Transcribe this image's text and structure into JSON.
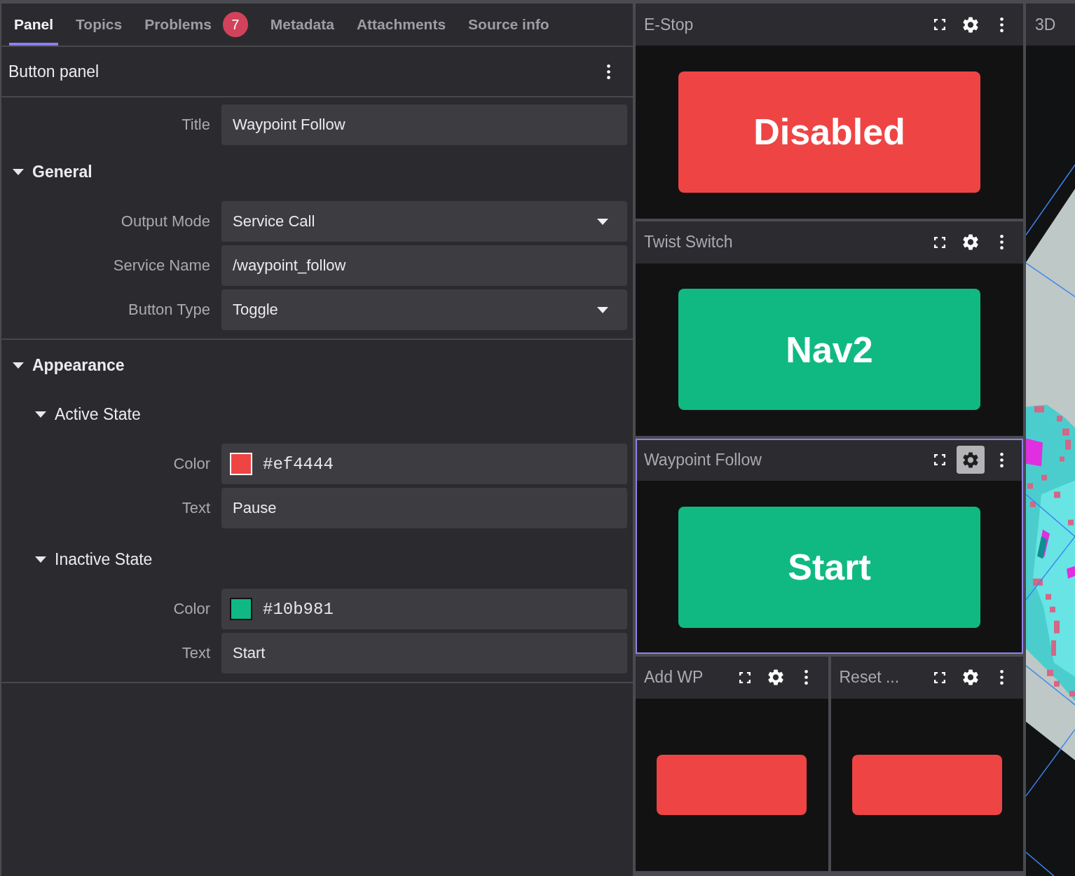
{
  "sidebar": {
    "tabs": [
      {
        "label": "Panel",
        "selected": true
      },
      {
        "label": "Topics",
        "selected": false
      },
      {
        "label": "Problems",
        "selected": false,
        "badge": "7"
      },
      {
        "label": "Metadata",
        "selected": false
      },
      {
        "label": "Attachments",
        "selected": false
      },
      {
        "label": "Source info",
        "selected": false
      }
    ],
    "title": "Button panel",
    "fields": [
      {
        "kind": "text",
        "label": "Title",
        "value": "Waypoint Follow"
      }
    ],
    "sections": [
      {
        "title": "General",
        "expanded": true,
        "fields": [
          {
            "kind": "select",
            "label": "Output Mode",
            "value": "Service Call"
          },
          {
            "kind": "text",
            "label": "Service Name",
            "value": "/waypoint_follow"
          },
          {
            "kind": "select",
            "label": "Button Type",
            "value": "Toggle"
          }
        ]
      },
      {
        "title": "Appearance",
        "expanded": true,
        "children": [
          {
            "title": "Active State",
            "expanded": true,
            "fields": [
              {
                "kind": "color",
                "label": "Color",
                "value": "#ef4444",
                "color": "#ef4444"
              },
              {
                "kind": "text",
                "label": "Text",
                "value": "Pause"
              }
            ]
          },
          {
            "title": "Inactive State",
            "expanded": true,
            "fields": [
              {
                "kind": "color",
                "label": "Color",
                "value": "#10b981",
                "color": "#10b981"
              },
              {
                "kind": "text",
                "label": "Text",
                "value": "Start"
              }
            ]
          }
        ]
      }
    ]
  },
  "panel_grid": {
    "rows": [
      {
        "panels": [
          {
            "title": "E-Stop",
            "selected": false,
            "settings_open": false,
            "button": {
              "text": "Disabled",
              "color": "#ef4444"
            }
          }
        ]
      },
      {
        "panels": [
          {
            "title": "Twist Switch",
            "selected": false,
            "settings_open": false,
            "button": {
              "text": "Nav2",
              "color": "#10b981"
            }
          }
        ]
      },
      {
        "panels": [
          {
            "title": "Waypoint Follow",
            "selected": true,
            "settings_open": true,
            "button": {
              "text": "Start",
              "color": "#10b981"
            }
          }
        ]
      },
      {
        "panels": [
          {
            "title": "Add WP",
            "selected": false,
            "settings_open": false,
            "button": {
              "color": "#ef4444"
            }
          },
          {
            "title": "Reset ...",
            "selected": false,
            "settings_open": false,
            "button": {
              "color": "#ef4444"
            }
          }
        ]
      }
    ]
  },
  "viewport_3d": {
    "title": "3D"
  }
}
